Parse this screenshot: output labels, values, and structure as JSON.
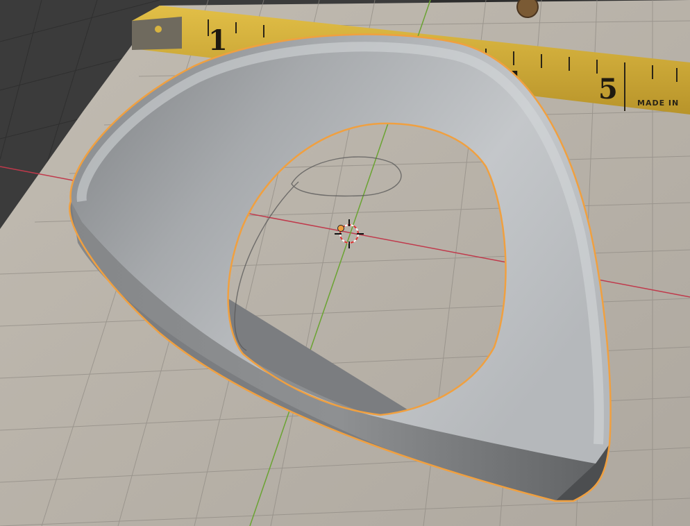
{
  "app": "3d-viewport",
  "colors": {
    "background": "#3b3b3b",
    "reference_paper": "#b9b3aa",
    "grid": "#8f8a83",
    "x_axis": "#c0394b",
    "y_axis": "#6aa332",
    "selection_outline": "#f0a040",
    "object_body": "#a9acaf",
    "tape": "#d9b43a"
  },
  "tape_measure": {
    "numbers": [
      "1",
      "4",
      "5"
    ],
    "footer_text": "MADE IN"
  },
  "scene": {
    "selected_object": "guitar-pick-shell",
    "origin_marker": "object-origin",
    "cursor_icon": "3d-cursor-icon"
  }
}
